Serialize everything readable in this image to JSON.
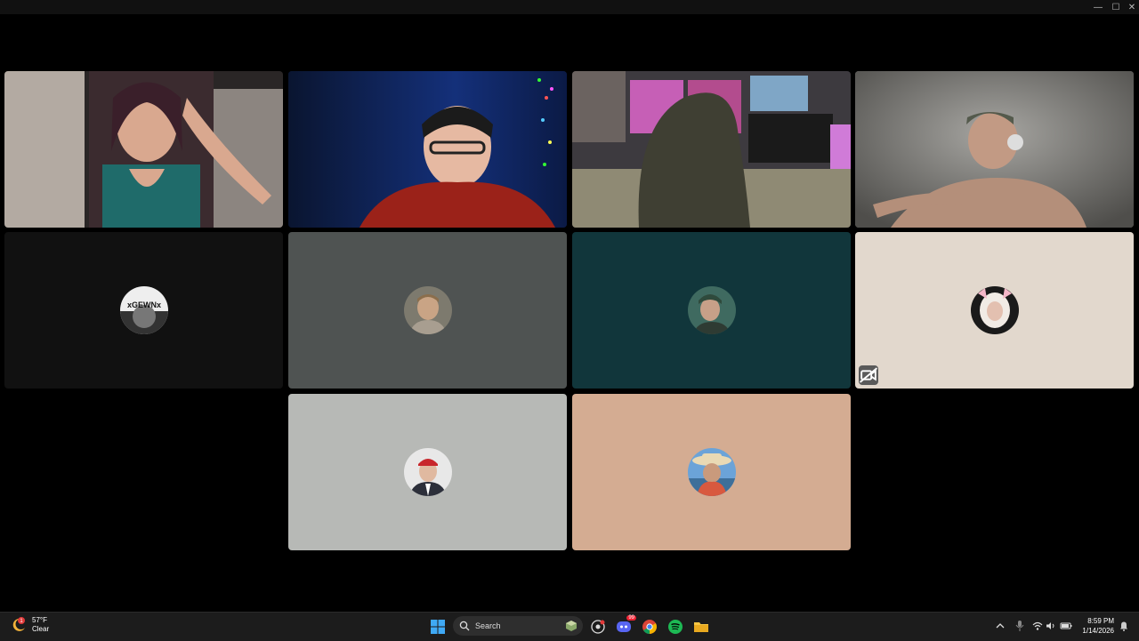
{
  "window": {
    "minimize_glyph": "—",
    "maximize_glyph": "☐",
    "close_glyph": "✕"
  },
  "call": {
    "tiles": [
      {
        "name": "participant-video-1",
        "kind": "video"
      },
      {
        "name": "participant-video-2",
        "kind": "video"
      },
      {
        "name": "participant-video-3",
        "kind": "video"
      },
      {
        "name": "participant-video-4",
        "kind": "video"
      },
      {
        "name": "participant-avatar-tile-1",
        "kind": "avatar",
        "bg": "#111111",
        "avatar_text": "xGEWNx"
      },
      {
        "name": "participant-avatar-tile-2",
        "kind": "avatar",
        "bg": "#4f5352"
      },
      {
        "name": "participant-avatar-tile-3",
        "kind": "avatar",
        "bg": "#11363b"
      },
      {
        "name": "participant-avatar-tile-4",
        "kind": "avatar",
        "bg": "#e2d8cd",
        "muted_icon": "camera-off-icon"
      },
      {
        "name": "participant-avatar-tile-5",
        "kind": "avatar",
        "bg": "#b7b9b6"
      },
      {
        "name": "participant-avatar-tile-6",
        "kind": "avatar",
        "bg": "#d4ac92"
      }
    ]
  },
  "taskbar": {
    "weather": {
      "temp": "57°F",
      "condition": "Clear",
      "icon": "moon-cloud-icon",
      "alert": "1"
    },
    "search_label": "Search",
    "discord_badge": "99",
    "clock": {
      "time": "8:59 PM",
      "date": "1/14/2026"
    },
    "icons": [
      "windows-start-icon",
      "search-icon",
      "widgets-icon",
      "game-icon",
      "discord-icon",
      "chrome-icon",
      "spotify-icon",
      "file-explorer-icon"
    ],
    "tray_icons": [
      "chevron-up-icon",
      "microphone-icon",
      "wifi-icon",
      "volume-icon",
      "battery-icon",
      "notification-bell-icon"
    ]
  }
}
